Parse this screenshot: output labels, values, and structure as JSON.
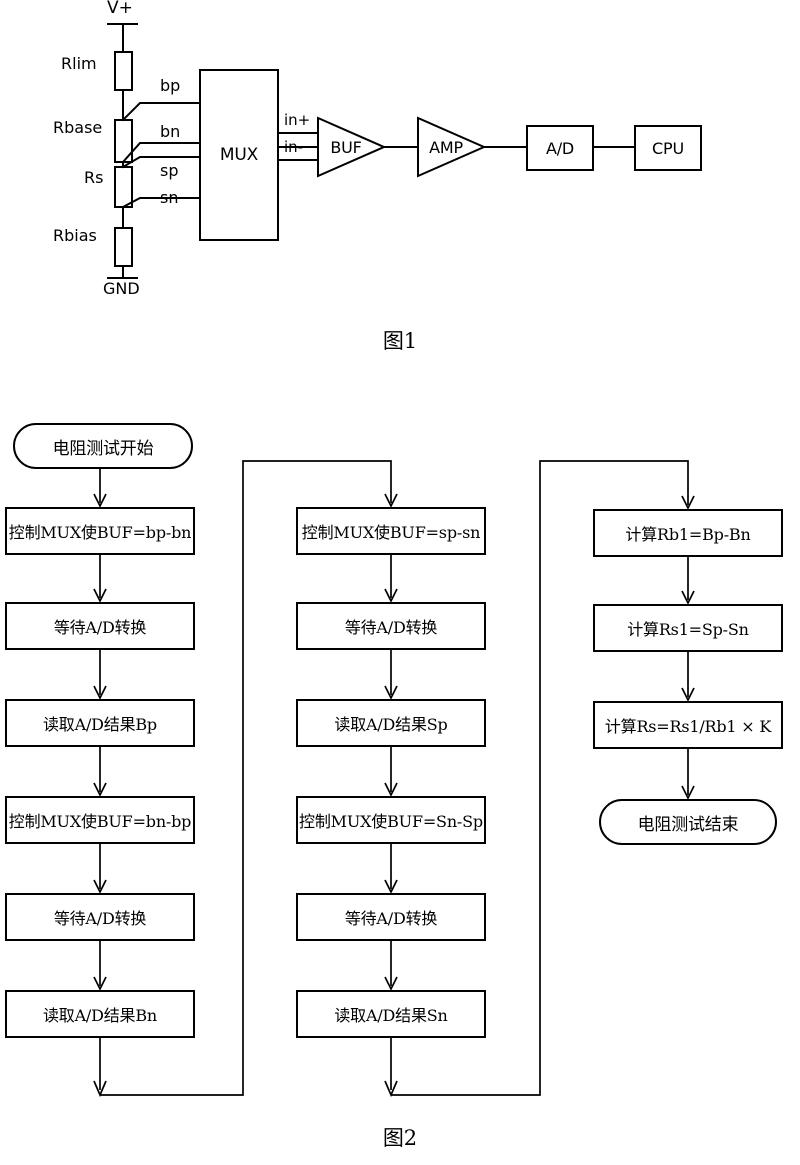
{
  "figure1": {
    "caption": "图1",
    "power_label": "V+",
    "ground_label": "GND",
    "resistors": [
      {
        "name": "Rlim",
        "label": "Rlim"
      },
      {
        "name": "Rbase",
        "label": "Rbase"
      },
      {
        "name": "Rs",
        "label": "Rs"
      },
      {
        "name": "Rbias",
        "label": "Rbias"
      }
    ],
    "taps": [
      "bp",
      "bn",
      "sp",
      "sn"
    ],
    "mux_label": "MUX",
    "buf_inputs": [
      "in+",
      "in-"
    ],
    "blocks": [
      "BUF",
      "AMP",
      "A/D",
      "CPU"
    ]
  },
  "figure2": {
    "caption": "图2",
    "start_label": "电阻测试开始",
    "end_label": "电阻测试结束",
    "column1": [
      "控制MUX使BUF=bp-bn",
      "等待A/D转换",
      "读取A/D结果Bp",
      "控制MUX使BUF=bn-bp",
      "等待A/D转换",
      "读取A/D结果Bn"
    ],
    "column2": [
      "控制MUX使BUF=sp-sn",
      "等待A/D转换",
      "读取A/D结果Sp",
      "控制MUX使BUF=Sn-Sp",
      "等待A/D转换",
      "读取A/D结果Sn"
    ],
    "column3": [
      "计算Rb1=Bp-Bn",
      "计算Rs1=Sp-Sn",
      "计算Rs=Rs1/Rb1 × K"
    ]
  },
  "colors": {
    "ink": "#000000",
    "paper": "#ffffff"
  }
}
